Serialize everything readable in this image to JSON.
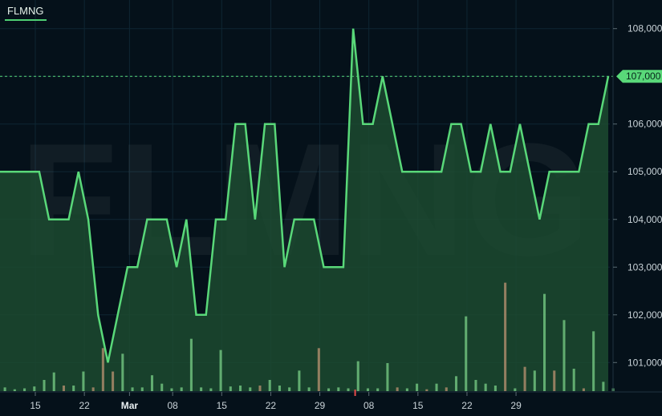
{
  "ticker": "FLMNG",
  "watermark": "FLMNG",
  "colors": {
    "background": "#05111a",
    "line": "#59d879",
    "area": "#1c4a30",
    "volume_up": "#6fbf7c",
    "volume_down": "#a98a6a",
    "marker": "#e84a4a",
    "last_price_fill": "#59d879"
  },
  "chart_data": {
    "type": "line",
    "series": [
      {
        "values": [
          105000,
          105000,
          105000,
          105000,
          105000,
          104000,
          104000,
          104000,
          105000,
          104000,
          102000,
          101000,
          102000,
          103000,
          103000,
          104000,
          104000,
          104000,
          103000,
          104000,
          102000,
          102000,
          104000,
          104000,
          106000,
          106000,
          104000,
          106000,
          106000,
          103000,
          104000,
          104000,
          104000,
          103000,
          103000,
          103000,
          108000,
          106000,
          106000,
          107000,
          106000,
          105000,
          105000,
          105000,
          105000,
          105000,
          106000,
          106000,
          105000,
          105000,
          106000,
          105000,
          105000,
          106000,
          105000,
          104000,
          105000,
          105000,
          105000,
          105000,
          106000,
          106000,
          107000
        ]
      }
    ],
    "volume": [
      {
        "v": 20,
        "up": true
      },
      {
        "v": 10,
        "up": true
      },
      {
        "v": 15,
        "up": true
      },
      {
        "v": 25,
        "up": true
      },
      {
        "v": 60,
        "up": true
      },
      {
        "v": 100,
        "up": true
      },
      {
        "v": 30,
        "up": false
      },
      {
        "v": 30,
        "up": true
      },
      {
        "v": 105,
        "up": true
      },
      {
        "v": 20,
        "up": false
      },
      {
        "v": 230,
        "up": false
      },
      {
        "v": 105,
        "up": false
      },
      {
        "v": 200,
        "up": true
      },
      {
        "v": 20,
        "up": true
      },
      {
        "v": 20,
        "up": true
      },
      {
        "v": 85,
        "up": true
      },
      {
        "v": 40,
        "up": true
      },
      {
        "v": 15,
        "up": true
      },
      {
        "v": 20,
        "up": true
      },
      {
        "v": 280,
        "up": true
      },
      {
        "v": 20,
        "up": true
      },
      {
        "v": 15,
        "up": true
      },
      {
        "v": 220,
        "up": true
      },
      {
        "v": 25,
        "up": true
      },
      {
        "v": 30,
        "up": true
      },
      {
        "v": 20,
        "up": true
      },
      {
        "v": 30,
        "up": false
      },
      {
        "v": 60,
        "up": true
      },
      {
        "v": 30,
        "up": true
      },
      {
        "v": 20,
        "up": true
      },
      {
        "v": 110,
        "up": true
      },
      {
        "v": 20,
        "up": true
      },
      {
        "v": 230,
        "up": false
      },
      {
        "v": 15,
        "up": true
      },
      {
        "v": 20,
        "up": true
      },
      {
        "v": 15,
        "up": true
      },
      {
        "v": 160,
        "up": true
      },
      {
        "v": 15,
        "up": true
      },
      {
        "v": 15,
        "up": true
      },
      {
        "v": 150,
        "up": true
      },
      {
        "v": 20,
        "up": false
      },
      {
        "v": 15,
        "up": true
      },
      {
        "v": 40,
        "up": true
      },
      {
        "v": 10,
        "up": false
      },
      {
        "v": 40,
        "up": true
      },
      {
        "v": 20,
        "up": false
      },
      {
        "v": 80,
        "up": true
      },
      {
        "v": 400,
        "up": true
      },
      {
        "v": 60,
        "up": true
      },
      {
        "v": 40,
        "up": true
      },
      {
        "v": 30,
        "up": true
      },
      {
        "v": 580,
        "up": false
      },
      {
        "v": 15,
        "up": true
      },
      {
        "v": 130,
        "up": false
      },
      {
        "v": 110,
        "up": true
      },
      {
        "v": 520,
        "up": true
      },
      {
        "v": 110,
        "up": false
      },
      {
        "v": 380,
        "up": true
      },
      {
        "v": 120,
        "up": true
      },
      {
        "v": 15,
        "up": false
      },
      {
        "v": 320,
        "up": true
      },
      {
        "v": 50,
        "up": true
      },
      {
        "v": 15,
        "up": true
      }
    ],
    "xticks": [
      {
        "label": "15",
        "pos": 3.6,
        "month": false
      },
      {
        "label": "22",
        "pos": 8.6,
        "month": false
      },
      {
        "label": "Mar",
        "pos": 13.2,
        "month": true
      },
      {
        "label": "08",
        "pos": 17.6,
        "month": false
      },
      {
        "label": "15",
        "pos": 22.6,
        "month": false
      },
      {
        "label": "22",
        "pos": 27.6,
        "month": false
      },
      {
        "label": "29",
        "pos": 32.6,
        "month": false
      },
      {
        "label": "08",
        "pos": 37.6,
        "month": false
      },
      {
        "label": "15",
        "pos": 42.6,
        "month": false
      },
      {
        "label": "22",
        "pos": 47.6,
        "month": false
      },
      {
        "label": "29",
        "pos": 52.6,
        "month": false
      }
    ],
    "yticks": [
      "101,000",
      "102,000",
      "103,000",
      "104,000",
      "105,000",
      "106,000",
      "107,000",
      "108,000"
    ],
    "ytick_values": [
      101000,
      102000,
      103000,
      104000,
      105000,
      106000,
      107000,
      108000
    ],
    "ylim": [
      100400,
      108600
    ],
    "last_price": 107000,
    "last_price_label": "107,000",
    "marker_index": 36.2,
    "grid": true
  }
}
